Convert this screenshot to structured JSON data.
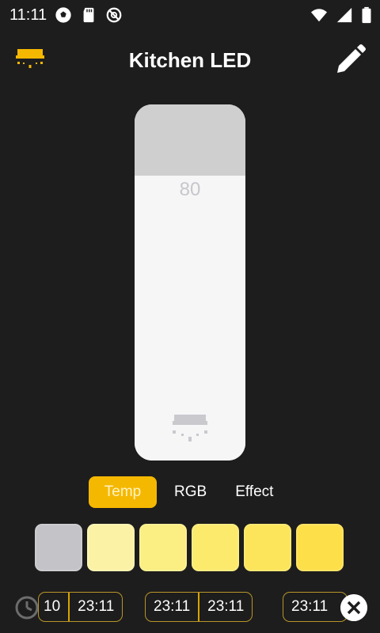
{
  "status_bar": {
    "time": "11:11",
    "icons": [
      "soccer-ball-icon",
      "sd-card-icon",
      "do-not-disturb-icon",
      "wifi-icon",
      "cellular-signal-icon",
      "battery-icon"
    ]
  },
  "header": {
    "title": "Kitchen LED",
    "left_icon": "ceiling-lamp-icon",
    "right_icon": "pencil-icon"
  },
  "brightness": {
    "value": 80,
    "value_label": "80",
    "icon": "ceiling-lamp-icon"
  },
  "mode_tabs": [
    {
      "label": "Temp",
      "active": true
    },
    {
      "label": "RGB",
      "active": false
    },
    {
      "label": "Effect",
      "active": false
    }
  ],
  "swatches": [
    {
      "color": "#c4c4c8"
    },
    {
      "color": "#fcf2a6"
    },
    {
      "color": "#fbee82"
    },
    {
      "color": "#fbea6c"
    },
    {
      "color": "#fce55a"
    },
    {
      "color": "#fddf4a"
    }
  ],
  "timers": [
    {
      "start": "10",
      "end": "23:11"
    },
    {
      "start": "23:11",
      "end": "23:11"
    },
    {
      "start": "23:11"
    }
  ],
  "colors": {
    "accent": "#f5b800",
    "background": "#1d1d1d",
    "timer_border": "#b8952a"
  }
}
